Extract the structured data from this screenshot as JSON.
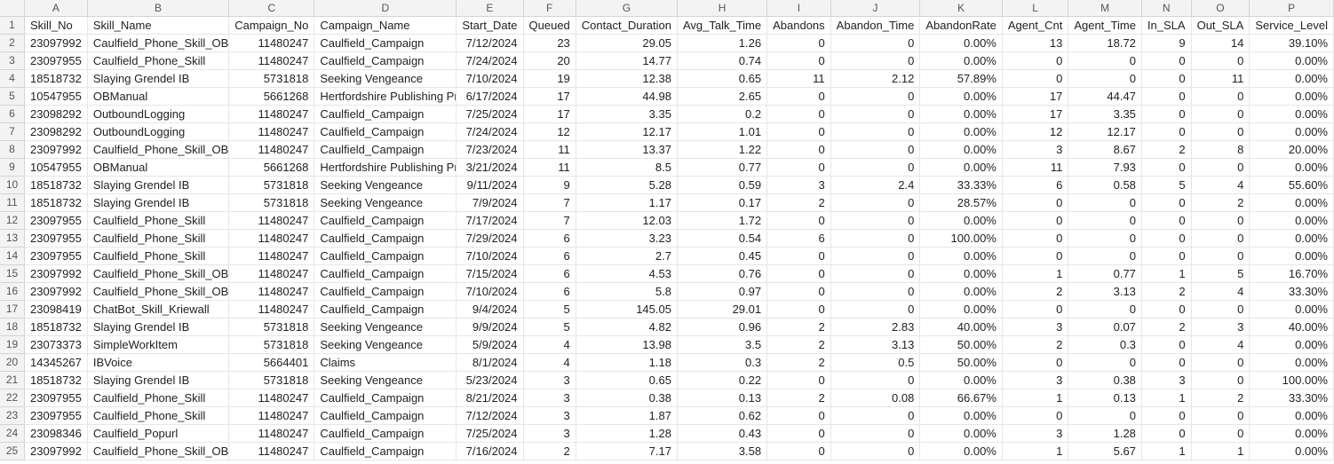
{
  "columns": [
    "A",
    "B",
    "C",
    "D",
    "E",
    "F",
    "G",
    "H",
    "I",
    "J",
    "K",
    "L",
    "M",
    "N",
    "O",
    "P"
  ],
  "col_align": [
    "r",
    "l",
    "r",
    "l",
    "r",
    "r",
    "r",
    "r",
    "r",
    "r",
    "r",
    "r",
    "r",
    "r",
    "r",
    "r"
  ],
  "header_row": [
    "Skill_No",
    "Skill_Name",
    "Campaign_No",
    "Campaign_Name",
    "Start_Date",
    "Queued",
    "Contact_Duration",
    "Avg_Talk_Time",
    "Abandons",
    "Abandon_Time",
    "AbandonRate",
    "Agent_Cnt",
    "Agent_Time",
    "In_SLA",
    "Out_SLA",
    "Service_Level"
  ],
  "rows": [
    [
      "23097992",
      "Caulfield_Phone_Skill_OB",
      "11480247",
      "Caulfield_Campaign",
      "7/12/2024",
      "23",
      "29.05",
      "1.26",
      "0",
      "0",
      "0.00%",
      "13",
      "18.72",
      "9",
      "14",
      "39.10%"
    ],
    [
      "23097955",
      "Caulfield_Phone_Skill",
      "11480247",
      "Caulfield_Campaign",
      "7/24/2024",
      "20",
      "14.77",
      "0.74",
      "0",
      "0",
      "0.00%",
      "0",
      "0",
      "0",
      "0",
      "0.00%"
    ],
    [
      "18518732",
      "Slaying Grendel IB",
      "5731818",
      "Seeking Vengeance",
      "7/10/2024",
      "19",
      "12.38",
      "0.65",
      "11",
      "2.12",
      "57.89%",
      "0",
      "0",
      "0",
      "11",
      "0.00%"
    ],
    [
      "10547955",
      "OBManual",
      "5661268",
      "Hertfordshire Publishing Promo",
      "6/17/2024",
      "17",
      "44.98",
      "2.65",
      "0",
      "0",
      "0.00%",
      "17",
      "44.47",
      "0",
      "0",
      "0.00%"
    ],
    [
      "23098292",
      "OutboundLogging",
      "11480247",
      "Caulfield_Campaign",
      "7/25/2024",
      "17",
      "3.35",
      "0.2",
      "0",
      "0",
      "0.00%",
      "17",
      "3.35",
      "0",
      "0",
      "0.00%"
    ],
    [
      "23098292",
      "OutboundLogging",
      "11480247",
      "Caulfield_Campaign",
      "7/24/2024",
      "12",
      "12.17",
      "1.01",
      "0",
      "0",
      "0.00%",
      "12",
      "12.17",
      "0",
      "0",
      "0.00%"
    ],
    [
      "23097992",
      "Caulfield_Phone_Skill_OB",
      "11480247",
      "Caulfield_Campaign",
      "7/23/2024",
      "11",
      "13.37",
      "1.22",
      "0",
      "0",
      "0.00%",
      "3",
      "8.67",
      "2",
      "8",
      "20.00%"
    ],
    [
      "10547955",
      "OBManual",
      "5661268",
      "Hertfordshire Publishing Promo",
      "3/21/2024",
      "11",
      "8.5",
      "0.77",
      "0",
      "0",
      "0.00%",
      "11",
      "7.93",
      "0",
      "0",
      "0.00%"
    ],
    [
      "18518732",
      "Slaying Grendel IB",
      "5731818",
      "Seeking Vengeance",
      "9/11/2024",
      "9",
      "5.28",
      "0.59",
      "3",
      "2.4",
      "33.33%",
      "6",
      "0.58",
      "5",
      "4",
      "55.60%"
    ],
    [
      "18518732",
      "Slaying Grendel IB",
      "5731818",
      "Seeking Vengeance",
      "7/9/2024",
      "7",
      "1.17",
      "0.17",
      "2",
      "0",
      "28.57%",
      "0",
      "0",
      "0",
      "2",
      "0.00%"
    ],
    [
      "23097955",
      "Caulfield_Phone_Skill",
      "11480247",
      "Caulfield_Campaign",
      "7/17/2024",
      "7",
      "12.03",
      "1.72",
      "0",
      "0",
      "0.00%",
      "0",
      "0",
      "0",
      "0",
      "0.00%"
    ],
    [
      "23097955",
      "Caulfield_Phone_Skill",
      "11480247",
      "Caulfield_Campaign",
      "7/29/2024",
      "6",
      "3.23",
      "0.54",
      "6",
      "0",
      "100.00%",
      "0",
      "0",
      "0",
      "0",
      "0.00%"
    ],
    [
      "23097955",
      "Caulfield_Phone_Skill",
      "11480247",
      "Caulfield_Campaign",
      "7/10/2024",
      "6",
      "2.7",
      "0.45",
      "0",
      "0",
      "0.00%",
      "0",
      "0",
      "0",
      "0",
      "0.00%"
    ],
    [
      "23097992",
      "Caulfield_Phone_Skill_OB",
      "11480247",
      "Caulfield_Campaign",
      "7/15/2024",
      "6",
      "4.53",
      "0.76",
      "0",
      "0",
      "0.00%",
      "1",
      "0.77",
      "1",
      "5",
      "16.70%"
    ],
    [
      "23097992",
      "Caulfield_Phone_Skill_OB",
      "11480247",
      "Caulfield_Campaign",
      "7/10/2024",
      "6",
      "5.8",
      "0.97",
      "0",
      "0",
      "0.00%",
      "2",
      "3.13",
      "2",
      "4",
      "33.30%"
    ],
    [
      "23098419",
      "ChatBot_Skill_Kriewall",
      "11480247",
      "Caulfield_Campaign",
      "9/4/2024",
      "5",
      "145.05",
      "29.01",
      "0",
      "0",
      "0.00%",
      "0",
      "0",
      "0",
      "0",
      "0.00%"
    ],
    [
      "18518732",
      "Slaying Grendel IB",
      "5731818",
      "Seeking Vengeance",
      "9/9/2024",
      "5",
      "4.82",
      "0.96",
      "2",
      "2.83",
      "40.00%",
      "3",
      "0.07",
      "2",
      "3",
      "40.00%"
    ],
    [
      "23073373",
      "SimpleWorkItem",
      "5731818",
      "Seeking Vengeance",
      "5/9/2024",
      "4",
      "13.98",
      "3.5",
      "2",
      "3.13",
      "50.00%",
      "2",
      "0.3",
      "0",
      "4",
      "0.00%"
    ],
    [
      "14345267",
      "IBVoice",
      "5664401",
      "Claims",
      "8/1/2024",
      "4",
      "1.18",
      "0.3",
      "2",
      "0.5",
      "50.00%",
      "0",
      "0",
      "0",
      "0",
      "0.00%"
    ],
    [
      "18518732",
      "Slaying Grendel IB",
      "5731818",
      "Seeking Vengeance",
      "5/23/2024",
      "3",
      "0.65",
      "0.22",
      "0",
      "0",
      "0.00%",
      "3",
      "0.38",
      "3",
      "0",
      "100.00%"
    ],
    [
      "23097955",
      "Caulfield_Phone_Skill",
      "11480247",
      "Caulfield_Campaign",
      "8/21/2024",
      "3",
      "0.38",
      "0.13",
      "2",
      "0.08",
      "66.67%",
      "1",
      "0.13",
      "1",
      "2",
      "33.30%"
    ],
    [
      "23097955",
      "Caulfield_Phone_Skill",
      "11480247",
      "Caulfield_Campaign",
      "7/12/2024",
      "3",
      "1.87",
      "0.62",
      "0",
      "0",
      "0.00%",
      "0",
      "0",
      "0",
      "0",
      "0.00%"
    ],
    [
      "23098346",
      "Caulfield_Popurl",
      "11480247",
      "Caulfield_Campaign",
      "7/25/2024",
      "3",
      "1.28",
      "0.43",
      "0",
      "0",
      "0.00%",
      "3",
      "1.28",
      "0",
      "0",
      "0.00%"
    ],
    [
      "23097992",
      "Caulfield_Phone_Skill_OB",
      "11480247",
      "Caulfield_Campaign",
      "7/16/2024",
      "2",
      "7.17",
      "3.58",
      "0",
      "0",
      "0.00%",
      "1",
      "5.67",
      "1",
      "1",
      "0.00%"
    ]
  ]
}
